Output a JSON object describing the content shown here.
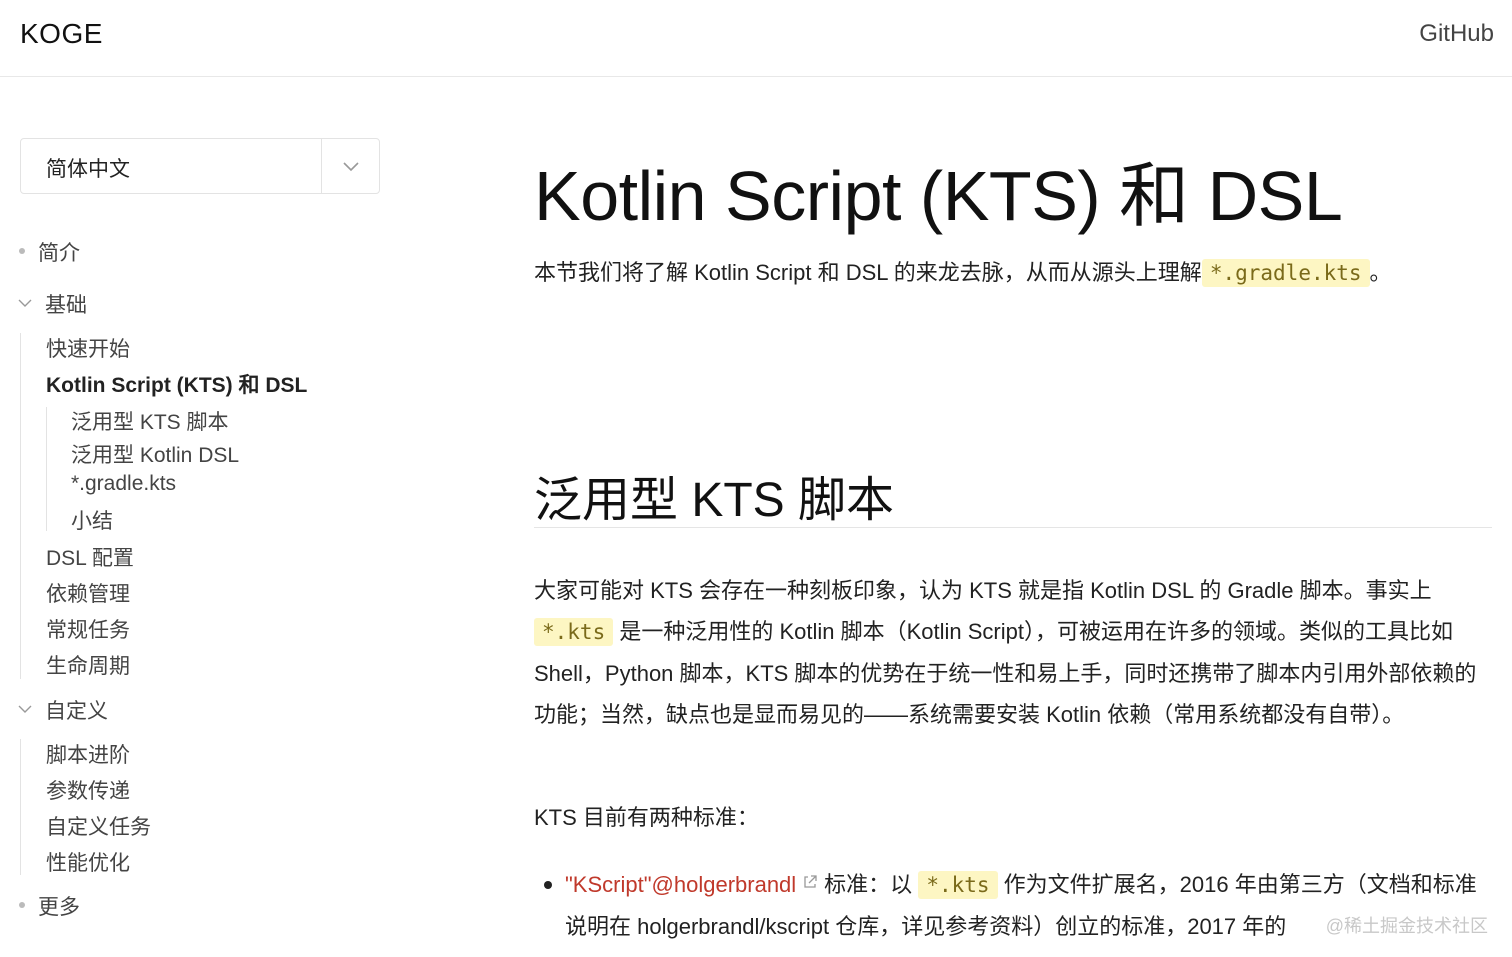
{
  "header": {
    "logo": "KOGE",
    "github": "GitHub"
  },
  "sidebar": {
    "language": "简体中文",
    "items": [
      {
        "label": "简介"
      },
      {
        "label": "基础"
      },
      {
        "label": "快速开始"
      },
      {
        "label": "Kotlin Script (KTS) 和 DSL"
      },
      {
        "label": "泛用型 KTS 脚本"
      },
      {
        "label": "泛用型 Kotlin DSL"
      },
      {
        "label": "*.gradle.kts"
      },
      {
        "label": "小结"
      },
      {
        "label": "DSL 配置"
      },
      {
        "label": "依赖管理"
      },
      {
        "label": "常规任务"
      },
      {
        "label": "生命周期"
      },
      {
        "label": "自定义"
      },
      {
        "label": "脚本进阶"
      },
      {
        "label": "参数传递"
      },
      {
        "label": "自定义任务"
      },
      {
        "label": "性能优化"
      },
      {
        "label": "更多"
      }
    ]
  },
  "main": {
    "title": "Kotlin Script (KTS) 和 DSL",
    "intro_text": "本节我们将了解 Kotlin Script 和 DSL 的来龙去脉，从而从源头上理解",
    "intro_code": "*.gradle.kts",
    "intro_end": "。",
    "section_title": "泛用型 KTS 脚本",
    "p1_a": "大家可能对 KTS 会存在一种刻板印象，认为 KTS 就是指 Kotlin DSL 的 Gradle 脚本。事实上",
    "p1_code": "*.kts",
    "p1_b": "是一种泛用性的 Kotlin 脚本（Kotlin Script），可被运用在许多的领域。类似的工具比如 Shell，Python 脚本，KTS 脚本的优势在于统一性和易上手，同时还携带了脚本内引用外部依赖的功能；当然，缺点也是显而易见的——系统需要安装 Kotlin 依赖（常用系统都没有自带）。",
    "p2": "KTS 目前有两种标准：",
    "li1_link": "\"KScript\"@holgerbrandl",
    "li1_a": "标准：以",
    "li1_code": "*.kts",
    "li1_b": "作为文件扩展名，2016 年由第三方（文档和标准说明在 holgerbrandl/kscript 仓库，详见参考资料）创立的标准，2017 年的"
  },
  "watermark": "@稀土掘金技术社区"
}
